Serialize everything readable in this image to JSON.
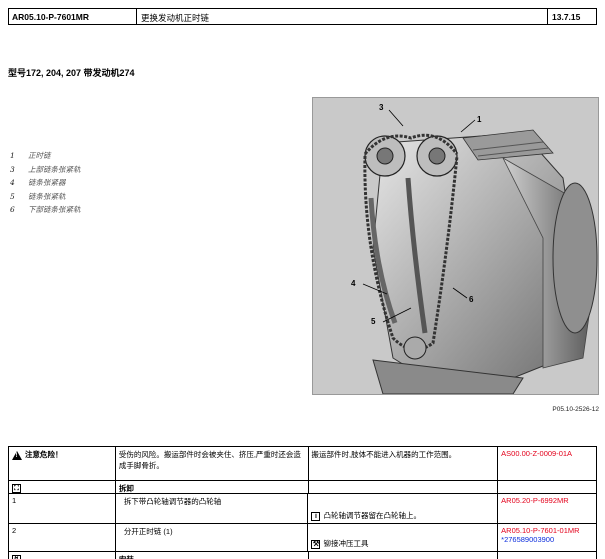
{
  "header": {
    "doc_id": "AR05.10-P-7601MR",
    "title": "更换发动机正时链",
    "date": "13.7.15"
  },
  "subtitle": "型号172, 204, 207 带发动机274",
  "legend": [
    {
      "num": "1",
      "text": "正时链"
    },
    {
      "num": "3",
      "text": "上部链条张紧轨"
    },
    {
      "num": "4",
      "text": "链条张紧器"
    },
    {
      "num": "5",
      "text": "链条张紧轨"
    },
    {
      "num": "6",
      "text": "下部链条张紧轨"
    }
  ],
  "figure": {
    "callouts": [
      "3",
      "1",
      "4",
      "5",
      "6"
    ],
    "caption": "P05.10-2526-12"
  },
  "table": {
    "rows": [
      {
        "c1_icon": "!",
        "c1": "注意危险！",
        "c2": "受伤的风险。搬运部件时会被夹住、挤压,严重时还会造成手脚骨折。",
        "c3": "搬运部件时,肢体不能进入机器的工作范围。",
        "c4": "AS00.00-Z-0009-01A"
      },
      {
        "c1_icon": "⛶",
        "c1": "",
        "c2": "拆卸",
        "c3": "",
        "c4": ""
      },
      {
        "c1": "1",
        "c2": "拆下带凸轮轴调节器的凸轮轴",
        "c3_icon": "i",
        "c3": "凸轮轴调节器留在凸轮轴上。",
        "c4": "AR05.20-P-6992MR"
      },
      {
        "c1": "2",
        "c2": "分开正时链 (1)",
        "c3_icon": "⚒",
        "c3": "铆接冲压工具",
        "c4": "AR05.10-P-7601-01MR",
        "c4b": "*276589003900"
      },
      {
        "c1_icon": "↯",
        "c1": "",
        "c2": "安装",
        "c3": "",
        "c4": ""
      }
    ]
  }
}
